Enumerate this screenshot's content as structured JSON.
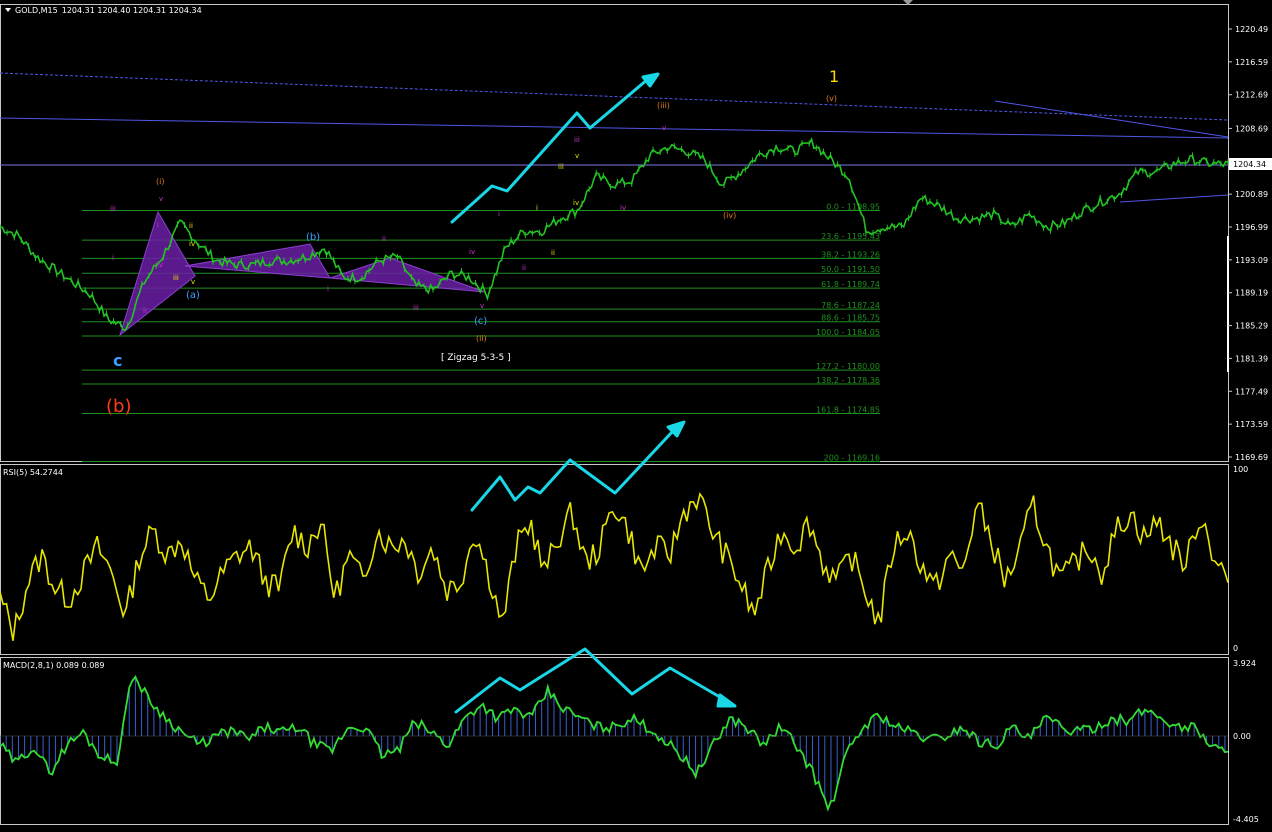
{
  "chart": {
    "symbol": "GOLD,M15",
    "ohlc": "1204.31 1204.40 1204.31 1204.34",
    "price_labels": [
      "1220.49",
      "1216.59",
      "1212.69",
      "1208.69",
      "1204.34",
      "1200.89",
      "1196.99",
      "1193.09",
      "1189.19",
      "1185.29",
      "1181.39",
      "1177.49",
      "1173.59",
      "1169.69"
    ],
    "colors": {
      "price": "#22c322",
      "rsi": "#e6e600",
      "macd_line": "#33dd33",
      "macd_hist": "#3a5fd0",
      "trend": "#4f57e6",
      "arrows": "#19d7e6",
      "zigzag": "#6a1fa3",
      "fib": "#1f8f1f"
    }
  },
  "labels": {
    "wave_1": "1",
    "wave_v_major": "(v)",
    "wave_iii_major": "(iii)",
    "wave_iv_major": "(iv)",
    "wave_i_major": "(i)",
    "wave_ii_major": "(ii)",
    "wave_a": "(a)",
    "wave_b": "(b)",
    "wave_c": "(c)",
    "c_big": "c",
    "b_big": "(b)",
    "zigzag": "[ Zigzag 5-3-5 ]"
  },
  "fib_levels": [
    "0.0 - 1198.95",
    "23.6 - 1195.43",
    "38.2 - 1193.26",
    "50.0 - 1191.50",
    "61.8 - 1189.74",
    "78.6 - 1187.24",
    "88.6 - 1185.75",
    "100.0 - 1184.05",
    "127.2 - 1180.00",
    "138.2 - 1178.36",
    "161.8 - 1174.85",
    "200 - 1169.16"
  ],
  "rsi": {
    "title": "RSI(5) 54.2744",
    "max": "100",
    "min": "0"
  },
  "macd": {
    "title": "MACD(2,8,1) 0.089 0.089",
    "max": "3.924",
    "zero": "0.00",
    "min": "-4.405"
  },
  "chart_data": {
    "type": "line",
    "title": "GOLD,M15",
    "ylim": [
      1169.69,
      1220.49
    ],
    "series": [
      {
        "name": "GOLD,M15",
        "values": [
          1197.0,
          1196.0,
          1193.5,
          1192.0,
          1190.5,
          1189.0,
          1186.0,
          1185.0,
          1190.5,
          1193.5,
          1197.5,
          1195.0,
          1193.0,
          1192.5,
          1192.5,
          1193.0,
          1193.0,
          1193.5,
          1194.5,
          1191.0,
          1191.0,
          1193.0,
          1193.5,
          1190.0,
          1189.5,
          1191.5,
          1191.0,
          1189.0,
          1194.5,
          1196.5,
          1196.5,
          1198.0,
          1199.0,
          1203.0,
          1202.0,
          1202.5,
          1205.5,
          1206.5,
          1206.0,
          1205.0,
          1202.0,
          1203.5,
          1205.5,
          1206.5,
          1206.0,
          1207.0,
          1205.0,
          1203.0,
          1196.5,
          1197.0,
          1197.0,
          1200.5,
          1199.5,
          1198.0,
          1198.0,
          1198.5,
          1197.0,
          1198.5,
          1197.0,
          1197.5,
          1199.0,
          1200.0,
          1201.0,
          1203.5,
          1203.5,
          1204.5,
          1205.0,
          1204.5,
          1204.4
        ]
      }
    ]
  }
}
